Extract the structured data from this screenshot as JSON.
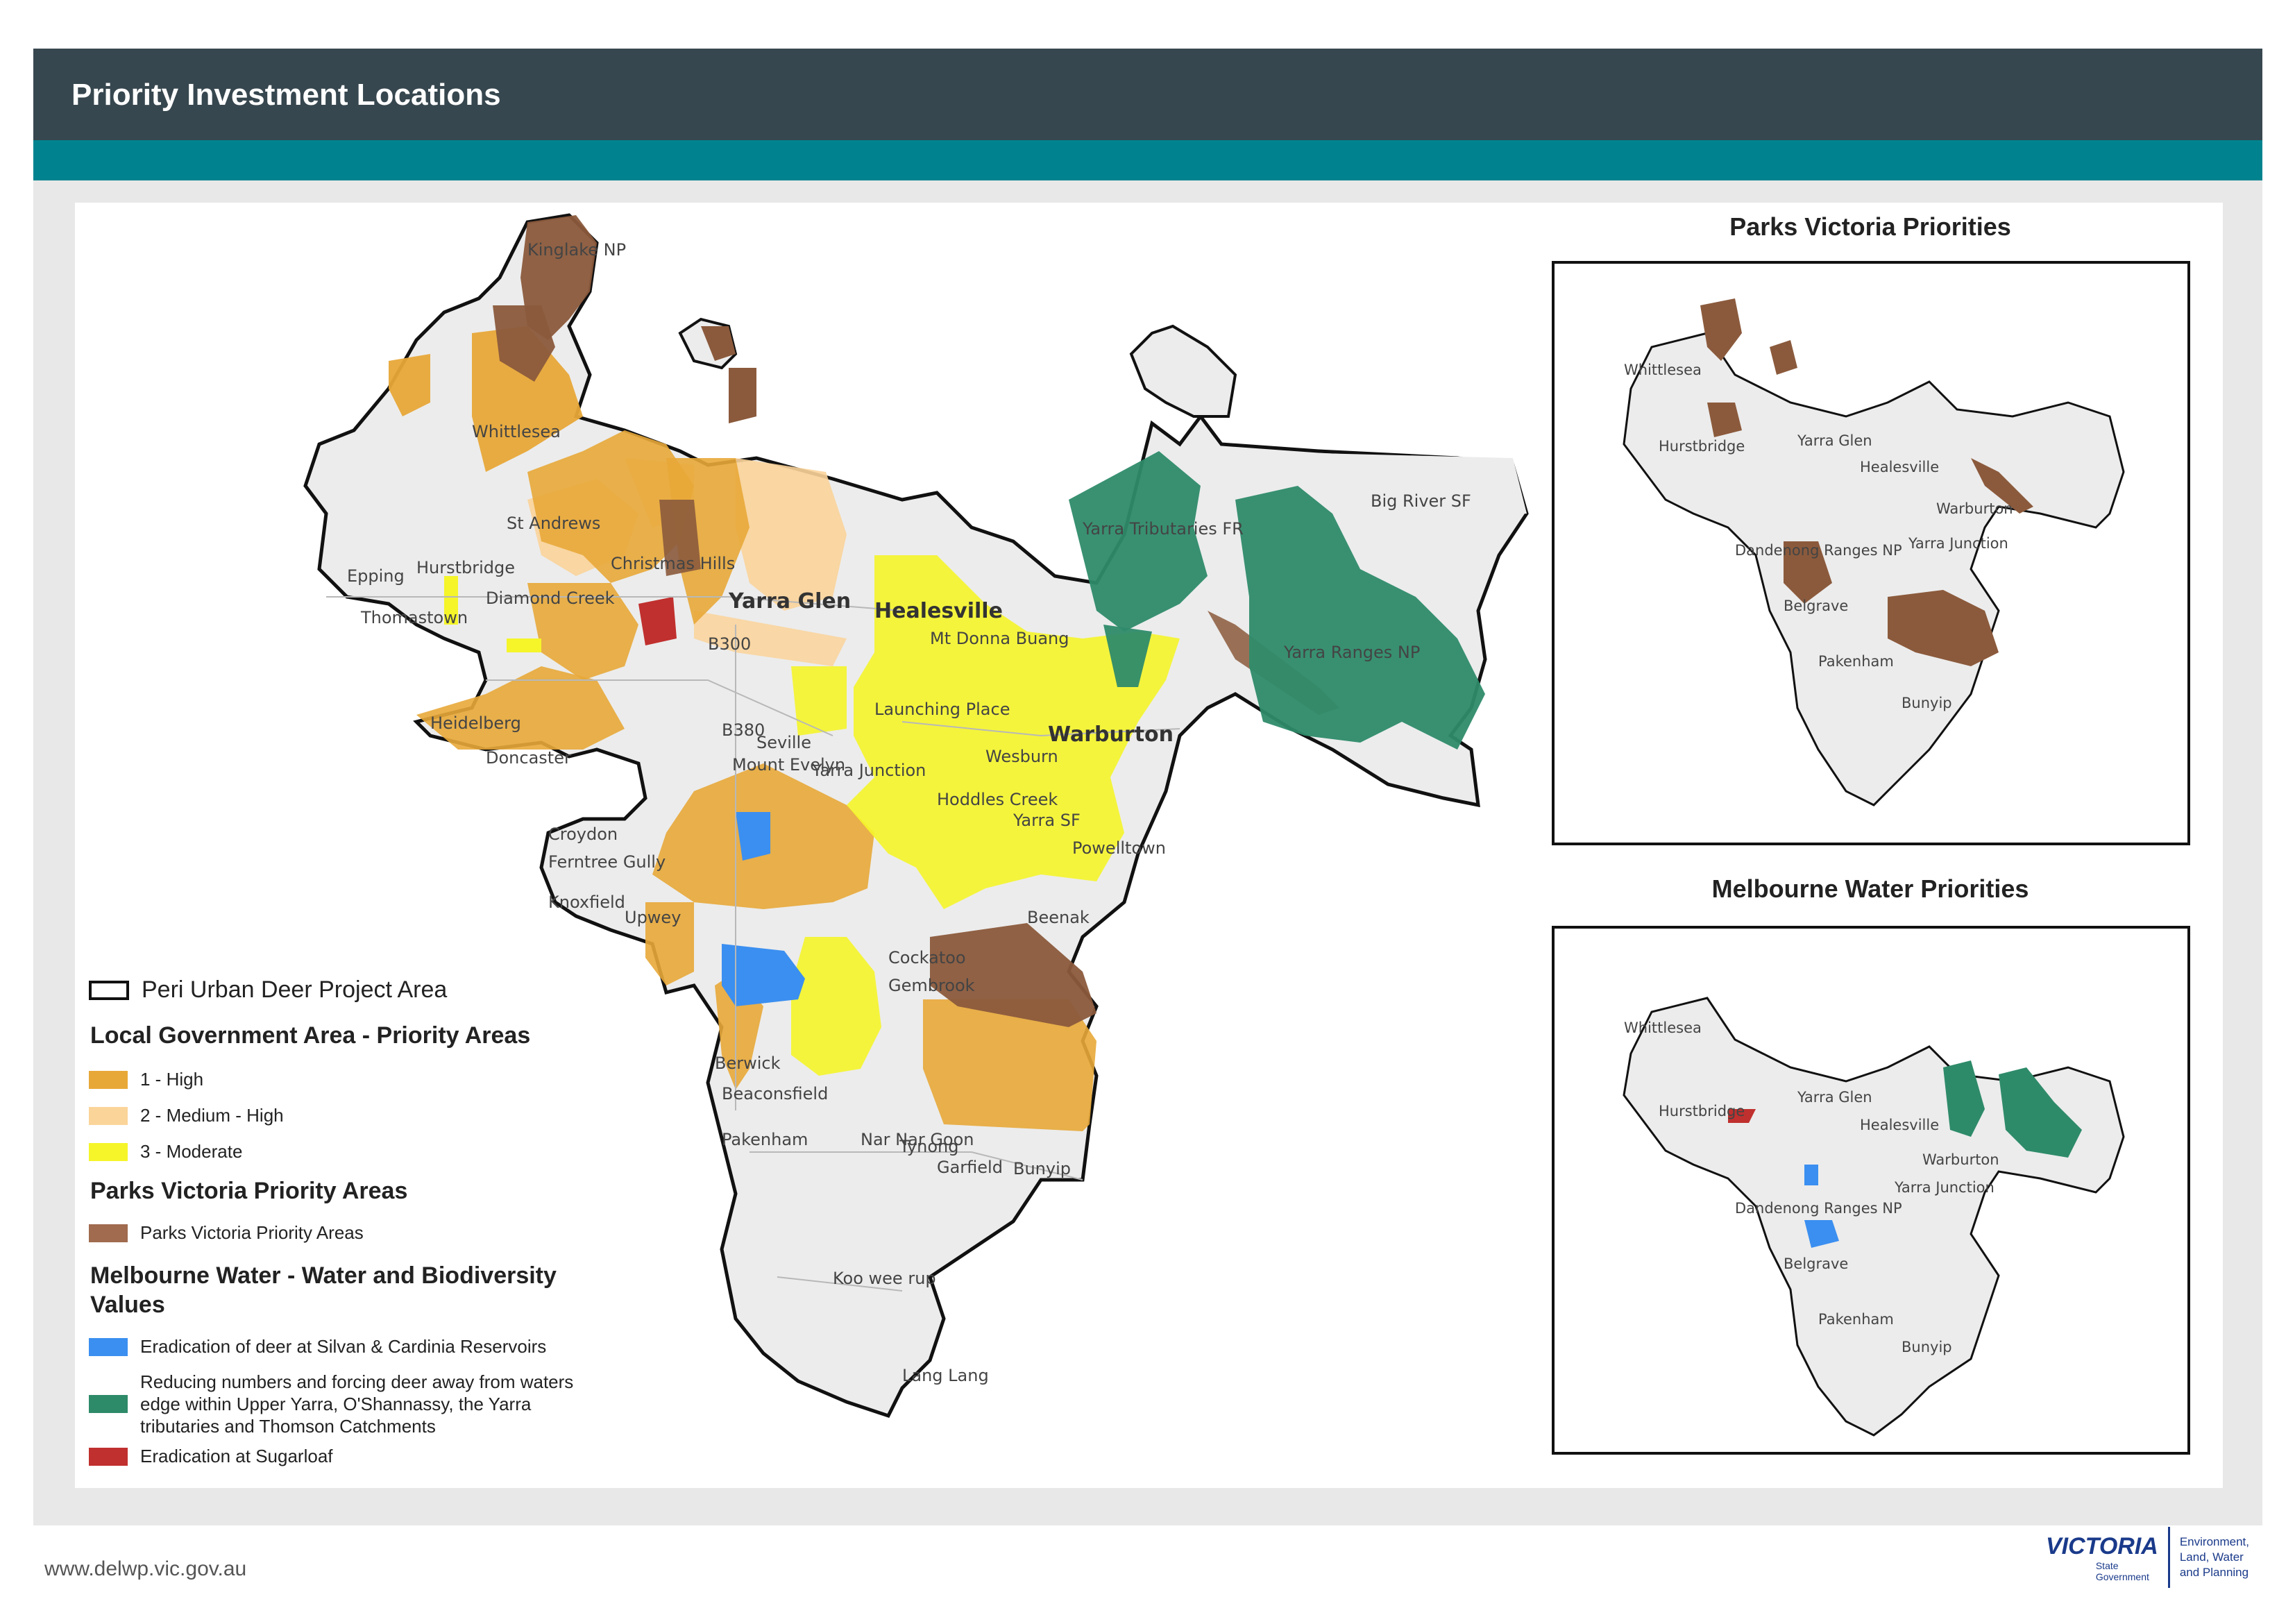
{
  "header": {
    "title": "Priority Investment Locations"
  },
  "colors": {
    "header_bg": "#37474f",
    "teal_bar": "#00838f",
    "lga_high": "#e8a838",
    "lga_medium_high": "#fbd49a",
    "lga_moderate": "#f5f52a",
    "parks_victoria": "#8b5a3c",
    "mw_silvan_cardinia": "#3b8ff0",
    "mw_upper_yarra": "#2e8b6a",
    "mw_sugarloaf": "#c0302e"
  },
  "insets": [
    {
      "title": "Parks Victoria Priorities"
    },
    {
      "title": "Melbourne Water Priorities"
    }
  ],
  "legend": {
    "project_area": "Peri Urban Deer Project Area",
    "lga_heading": "Local Government Area - Priority Areas",
    "lga_items": [
      "1 - High",
      "2 - Medium - High",
      "3 - Moderate"
    ],
    "parks_heading": "Parks Victoria Priority Areas",
    "parks_items": [
      "Parks Victoria Priority Areas"
    ],
    "mw_heading": "Melbourne Water - Water and Biodiversity Values",
    "mw_items": [
      "Eradication of deer at Silvan & Cardinia Reservoirs",
      "Reducing numbers and forcing deer away from waters edge within Upper Yarra, O'Shannassy, the Yarra tributaries and Thomson Catchments",
      "Eradication at Sugarloaf"
    ]
  },
  "map_labels": {
    "kinglake": "Kinglake NP",
    "whittlesea": "Whittlesea",
    "st_andrews": "St Andrews",
    "epping": "Epping",
    "hurstbridge": "Hurstbridge",
    "diamond_creek": "Diamond Creek",
    "christmas_hills": "Christmas Hills",
    "thomastown": "Thomastown",
    "yarra_glen": "Yarra Glen",
    "healesville": "Healesville",
    "mt_donna_buang": "Mt Donna Buang",
    "yarra_tributaries": "Yarra Tributaries FR",
    "big_river": "Big River SF",
    "yarra_ranges": "Yarra Ranges NP",
    "warburton": "Warburton",
    "wesburn": "Wesburn",
    "launching_place": "Launching Place",
    "yarra_junction": "Yarra Junction",
    "hoddles_creek": "Hoddles Creek",
    "yarra_sf": "Yarra SF",
    "seville": "Seville",
    "mount_evelyn": "Mount Evelyn",
    "heidelberg": "Heidelberg",
    "doncaster": "Doncaster",
    "croydon": "Croydon",
    "ferntree_gully": "Ferntree Gully",
    "knoxfield": "Knoxfield",
    "upwey": "Upwey",
    "cockatoo": "Cockatoo",
    "gembrook": "Gembrook",
    "beaconsfield": "Beaconsfield",
    "berwick": "Berwick",
    "pakenham": "Pakenham",
    "nar_nar_goon": "Nar Nar Goon",
    "tynong": "Tynong",
    "garfield": "Garfield",
    "bunyip": "Bunyip",
    "koo_wee_rup": "Koo wee rup",
    "lang_lang": "Lang Lang",
    "beenak": "Beenak",
    "powelltown": "Powelltown",
    "b300": "B300",
    "b380": "B380",
    "inset_healesville": "Healesville",
    "inset_warburton": "Warburton",
    "inset_yarra_glen": "Yarra Glen",
    "inset_yarra_junction": "Yarra Junction",
    "inset_pakenham": "Pakenham",
    "inset_bunyip": "Bunyip",
    "inset_whittlesea": "Whittlesea",
    "inset_hurstbridge": "Hurstbridge",
    "inset_belgrave": "Belgrave",
    "inset_dandenong": "Dandenong Ranges NP"
  },
  "footer": {
    "url": "www.delwp.vic.gov.au",
    "logo_word": "VICTORIA",
    "logo_sub": "State Government",
    "department": [
      "Environment,",
      "Land, Water",
      "and Planning"
    ]
  }
}
